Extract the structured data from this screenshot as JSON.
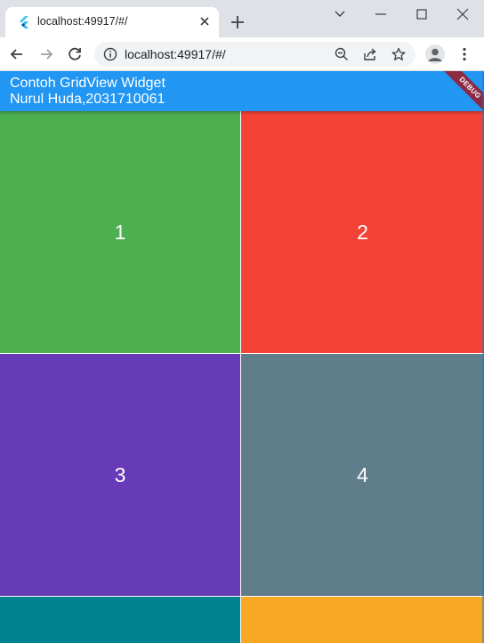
{
  "browser": {
    "tab_title": "localhost:49917/#/",
    "url": "localhost:49917/#/",
    "icons": {
      "favicon": "flutter-icon",
      "tab_close": "close-icon",
      "new_tab": "plus-icon",
      "back": "arrow-left-icon",
      "forward": "arrow-right-icon",
      "reload": "reload-icon",
      "site_info": "info-icon",
      "zoom": "zoom-out-icon",
      "share": "share-icon",
      "bookmark": "star-icon",
      "profile": "avatar-icon",
      "menu": "kebab-icon"
    }
  },
  "app": {
    "title_line1": "Contoh GridView Widget",
    "title_line2": "Nurul Huda,2031710061",
    "debug_label": "DEBUG",
    "appbar_color": "#2196f3"
  },
  "grid": {
    "items": [
      {
        "label": "1",
        "color": "#4caf50"
      },
      {
        "label": "2",
        "color": "#f44336"
      },
      {
        "label": "3",
        "color": "#673ab7"
      },
      {
        "label": "4",
        "color": "#607d8b"
      },
      {
        "label": "",
        "color": "#00838f"
      },
      {
        "label": "",
        "color": "#f9a825"
      }
    ]
  }
}
